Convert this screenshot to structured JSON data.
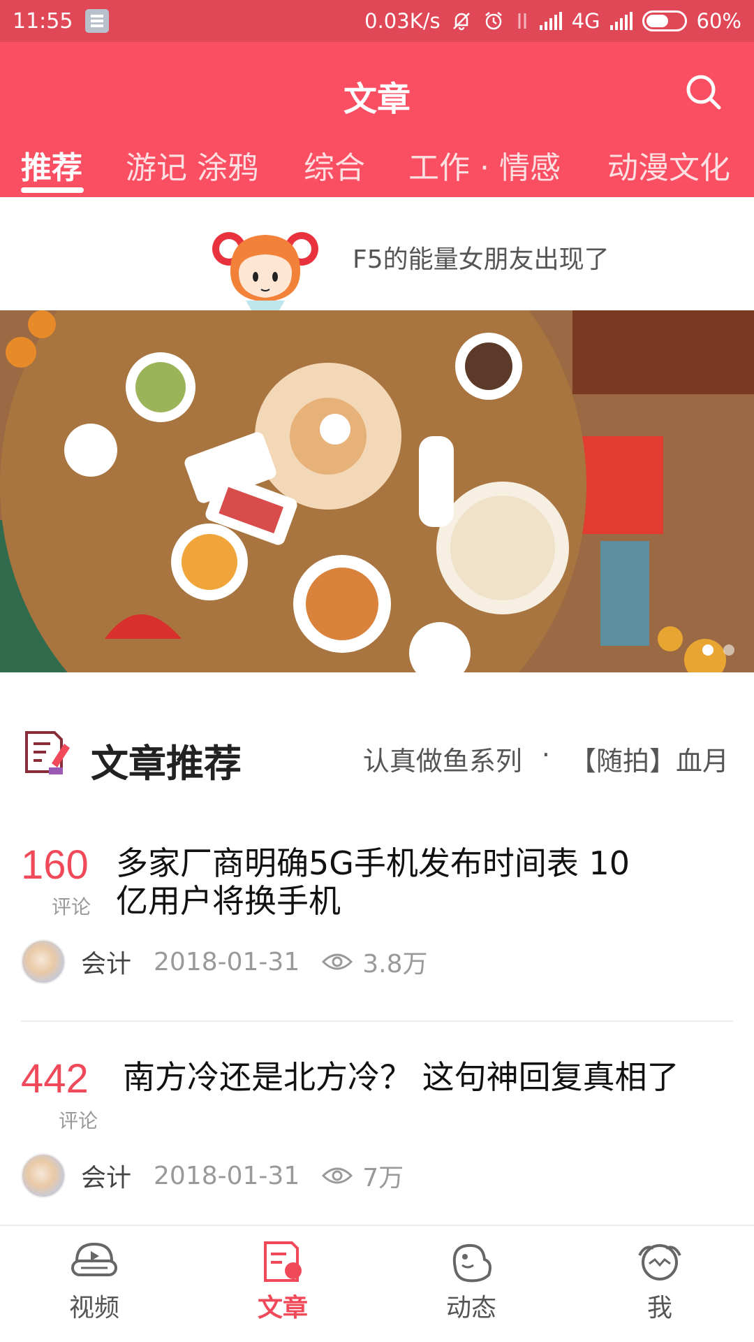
{
  "status_bar": {
    "time": "11:55",
    "network_speed": "0.03K/s",
    "network_type": "4G",
    "battery": "60%",
    "battery_level": 0.6
  },
  "header": {
    "title": "文章",
    "tabs": [
      "推荐",
      "游记 涂鸦",
      "综合",
      "工作 · 情感",
      "动漫文化"
    ],
    "active_tab": "推荐"
  },
  "notice": {
    "text": "F5的能量女朋友出现了"
  },
  "banner": {
    "page_count": 2,
    "active_page": 1
  },
  "section": {
    "title": "文章推荐",
    "links": [
      "认真做鱼系列",
      "·",
      "【随拍】血月"
    ]
  },
  "articles": [
    {
      "comments": "160",
      "comments_label": "评论",
      "title_line1": "多家厂商明确5G手机发布时间表 10",
      "title_line2": "亿用户将换手机",
      "author": "会计",
      "date": "2018-01-31",
      "views": "3.8万"
    },
    {
      "comments": "442",
      "comments_label": "评论",
      "title_line1": "南方冷还是北方冷？ 这句神回复真相了",
      "author": "会计",
      "date": "2018-01-31",
      "views": "7万"
    }
  ],
  "bottom_nav": [
    {
      "label": "视频",
      "icon": "video-icon"
    },
    {
      "label": "文章",
      "icon": "article-icon"
    },
    {
      "label": "动态",
      "icon": "moments-icon"
    },
    {
      "label": "我",
      "icon": "profile-icon"
    }
  ],
  "colors": {
    "brand": "#fa4f62",
    "accent_text": "#f04a5a"
  }
}
